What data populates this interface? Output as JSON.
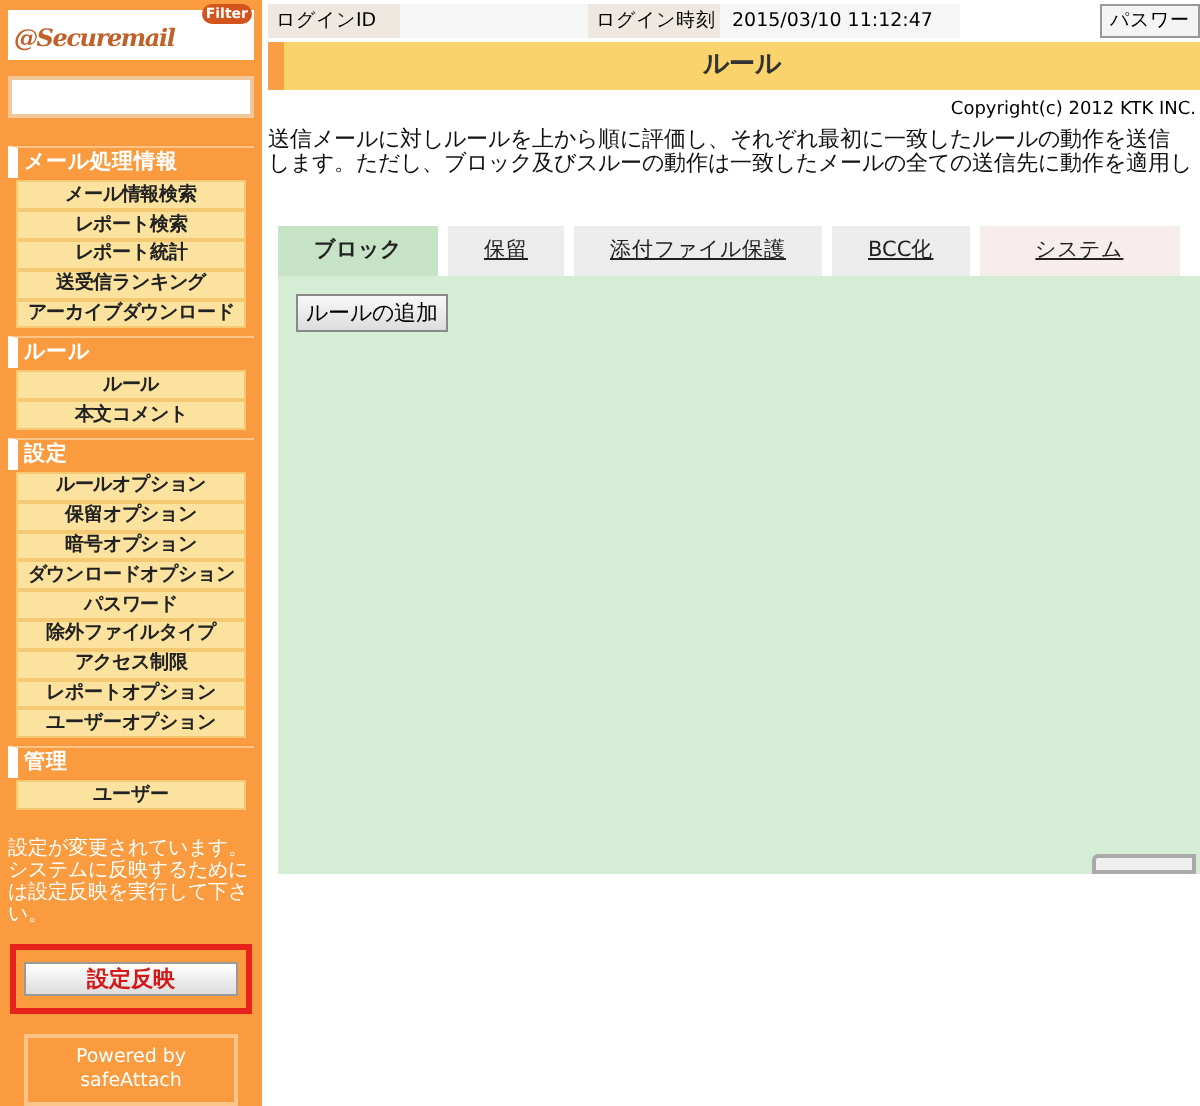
{
  "logo": {
    "text": "@Securemail",
    "badge": "Filter"
  },
  "sidebar": {
    "sections": [
      {
        "title": "メール処理情報",
        "items": [
          {
            "label": "メール情報検索"
          },
          {
            "label": "レポート検索"
          },
          {
            "label": "レポート統計"
          },
          {
            "label": "送受信ランキング"
          },
          {
            "label": "アーカイブダウンロード"
          }
        ]
      },
      {
        "title": "ルール",
        "items": [
          {
            "label": "ルール"
          },
          {
            "label": "本文コメント"
          }
        ]
      },
      {
        "title": "設定",
        "items": [
          {
            "label": "ルールオプション"
          },
          {
            "label": "保留オプション"
          },
          {
            "label": "暗号オプション"
          },
          {
            "label": "ダウンロードオプション"
          },
          {
            "label": "パスワード"
          },
          {
            "label": "除外ファイルタイプ"
          },
          {
            "label": "アクセス制限"
          },
          {
            "label": "レポートオプション"
          },
          {
            "label": "ユーザーオプション"
          }
        ]
      },
      {
        "title": "管理",
        "items": [
          {
            "label": "ユーザー"
          }
        ]
      }
    ],
    "notice": "設定が変更されています。システムに反映するためには設定反映を実行して下さい。",
    "apply_button": {
      "label": "設定反映",
      "highlighted": true
    },
    "powered_by": [
      "Powered by",
      "safeAttach"
    ]
  },
  "header": {
    "login_id_label": "ログインID",
    "login_time_label": "ログイン時刻",
    "login_time": "2015/03/10 11:12:47",
    "password_button": "パスワー"
  },
  "page_title": "ルール",
  "copyright": "Copyright(c) 2012 KTK INC.",
  "description": [
    "送信メールに対しルールを上から順に評価し、それぞれ最初に一致したルールの動作を送信",
    "します。ただし、ブロック及びスルーの動作は一致したメールの全ての送信先に動作を適用し"
  ],
  "tabs": [
    {
      "label": "ブロック",
      "selected": true,
      "color": "#c6e3c6"
    },
    {
      "label": "保留",
      "selected": false,
      "color": "#ececec"
    },
    {
      "label": "添付ファイル保護",
      "selected": false,
      "color": "#ececec"
    },
    {
      "label": "BCC化",
      "selected": false,
      "color": "#ececec"
    },
    {
      "label": "システム",
      "selected": false,
      "color": "#f7eded"
    }
  ],
  "add_rule_button": "ルールの追加"
}
